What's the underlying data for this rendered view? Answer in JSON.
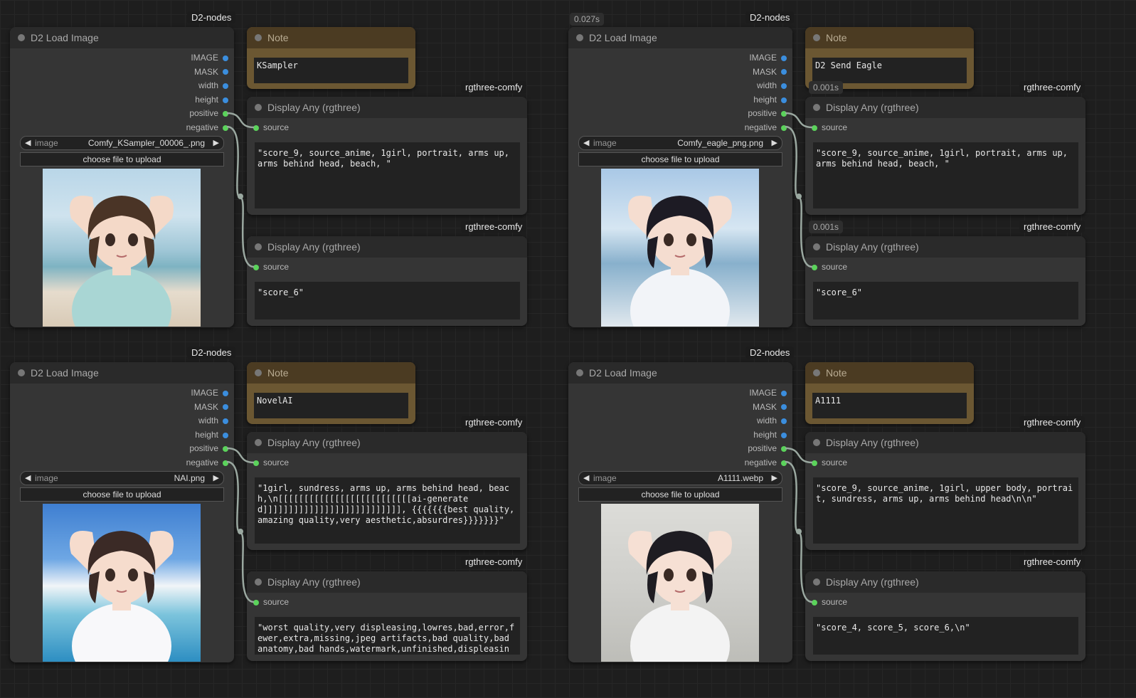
{
  "colors": {
    "accent_socket_image": "#3b8ede",
    "accent_socket_green": "#5bd35b",
    "note_header": "#4b3b22"
  },
  "groups": [
    {
      "load": {
        "badge": "D2-nodes",
        "title": "D2 Load Image",
        "timing": "",
        "outputs": [
          "IMAGE",
          "MASK",
          "width",
          "height",
          "positive",
          "negative"
        ],
        "image_label": "image",
        "image_value": "Comfy_KSampler_00006_.png",
        "upload": "choose file to upload"
      },
      "note": {
        "title": "Note",
        "text": "KSampler"
      },
      "disp1": {
        "badge": "rgthree-comfy",
        "title": "Display Any (rgthree)",
        "timing": "",
        "input": "source",
        "text": "\"score_9, source_anime, 1girl, portrait, arms up, arms behind head, beach, \""
      },
      "disp2": {
        "badge": "rgthree-comfy",
        "title": "Display Any (rgthree)",
        "timing": "",
        "input": "source",
        "text": "\"score_6\""
      }
    },
    {
      "load": {
        "badge": "D2-nodes",
        "title": "D2 Load Image",
        "timing": "0.027s",
        "outputs": [
          "IMAGE",
          "MASK",
          "width",
          "height",
          "positive",
          "negative"
        ],
        "image_label": "image",
        "image_value": "Comfy_eagle_png.png",
        "upload": "choose file to upload"
      },
      "note": {
        "title": "Note",
        "text": "D2 Send Eagle"
      },
      "disp1": {
        "badge": "rgthree-comfy",
        "title": "Display Any (rgthree)",
        "timing": "0.001s",
        "input": "source",
        "text": "\"score_9, source_anime, 1girl, portrait, arms up, arms behind head, beach, \""
      },
      "disp2": {
        "badge": "rgthree-comfy",
        "title": "Display Any (rgthree)",
        "timing": "0.001s",
        "input": "source",
        "text": "\"score_6\""
      }
    },
    {
      "load": {
        "badge": "D2-nodes",
        "title": "D2 Load Image",
        "timing": "",
        "outputs": [
          "IMAGE",
          "MASK",
          "width",
          "height",
          "positive",
          "negative"
        ],
        "image_label": "image",
        "image_value": "NAI.png",
        "upload": "choose file to upload"
      },
      "note": {
        "title": "Note",
        "text": "NovelAI"
      },
      "disp1": {
        "badge": "rgthree-comfy",
        "title": "Display Any (rgthree)",
        "timing": "",
        "input": "source",
        "text": "\"1girl, sundress, arms up, arms behind head, beach,\\n[[[[[[[[[[[[[[[[[[[[[[[[[[ai-generated]]]]]]]]]]]]]]]]]]]]]]]]]]], {{{{{{{best quality,amazing quality,very aesthetic,absurdres}}}}}}}\""
      },
      "disp2": {
        "badge": "rgthree-comfy",
        "title": "Display Any (rgthree)",
        "timing": "",
        "input": "source",
        "text": "\"worst quality,very displeasing,lowres,bad,error,fewer,extra,missing,jpeg artifacts,bad quality,bad anatomy,bad hands,watermark,unfinished,displeasing,chromatic"
      }
    },
    {
      "load": {
        "badge": "D2-nodes",
        "title": "D2 Load Image",
        "timing": "",
        "outputs": [
          "IMAGE",
          "MASK",
          "width",
          "height",
          "positive",
          "negative"
        ],
        "image_label": "image",
        "image_value": "A1111.webp",
        "upload": "choose file to upload"
      },
      "note": {
        "title": "Note",
        "text": "A1111"
      },
      "disp1": {
        "badge": "rgthree-comfy",
        "title": "Display Any (rgthree)",
        "timing": "",
        "input": "source",
        "text": "\"score_9, source_anime, 1girl, upper body, portrait, sundress, arms up, arms behind head\\n\\n\""
      },
      "disp2": {
        "badge": "rgthree-comfy",
        "title": "Display Any (rgthree)",
        "timing": "",
        "input": "source",
        "text": "\"score_4, score_5, score_6,\\n\""
      }
    }
  ]
}
